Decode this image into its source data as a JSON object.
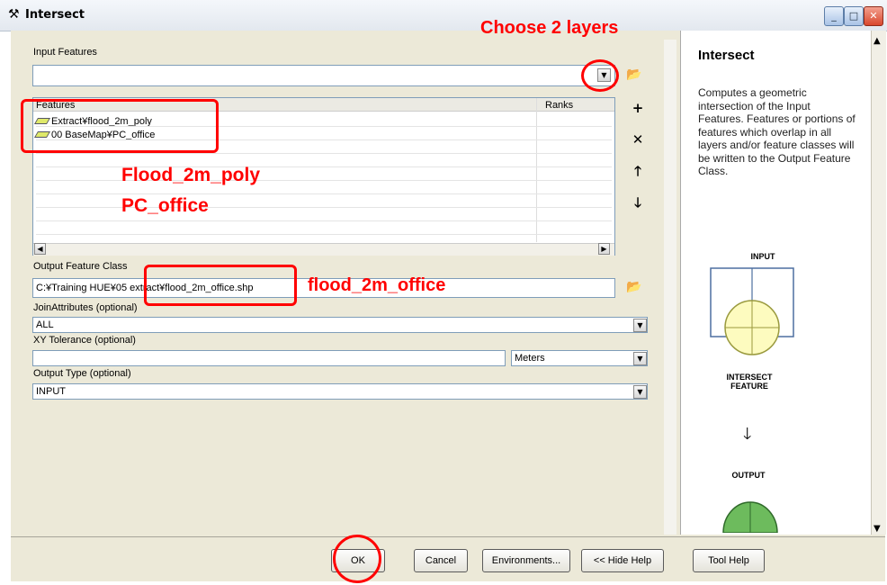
{
  "window": {
    "title": "Intersect"
  },
  "form": {
    "input_features_label": "Input Features",
    "features_col": "Features",
    "ranks_col": "Ranks",
    "features": [
      {
        "name": "Extract¥flood_2m_poly"
      },
      {
        "name": "00 BaseMap¥PC_office"
      }
    ],
    "output_label": "Output Feature Class",
    "output_value": "C:¥Training HUE¥05 extract¥flood_2m_office.shp",
    "join_label": "JoinAttributes (optional)",
    "join_value": "ALL",
    "xy_label": "XY Tolerance (optional)",
    "xy_units": "Meters",
    "output_type_label": "Output Type (optional)",
    "output_type_value": "INPUT"
  },
  "buttons": {
    "ok": "OK",
    "cancel": "Cancel",
    "environments": "Environments...",
    "hide_help": "<< Hide Help",
    "tool_help": "Tool Help"
  },
  "help": {
    "title": "Intersect",
    "text": "Computes a geometric intersection of the Input Features. Features or portions of features which overlap in all layers and/or feature classes will be written to the Output Feature Class.",
    "diagram": {
      "input": "INPUT",
      "intersect": "INTERSECT FEATURE",
      "output": "OUTPUT"
    }
  },
  "annotations": {
    "choose": "Choose 2 layers",
    "layer1": "Flood_2m_poly",
    "layer2": "PC_office",
    "output_name": "flood_2m_office"
  },
  "colors": {
    "annotation": "#ff0000",
    "diagram_input": "#fdfbbf",
    "diagram_output": "#6dbb5d"
  }
}
